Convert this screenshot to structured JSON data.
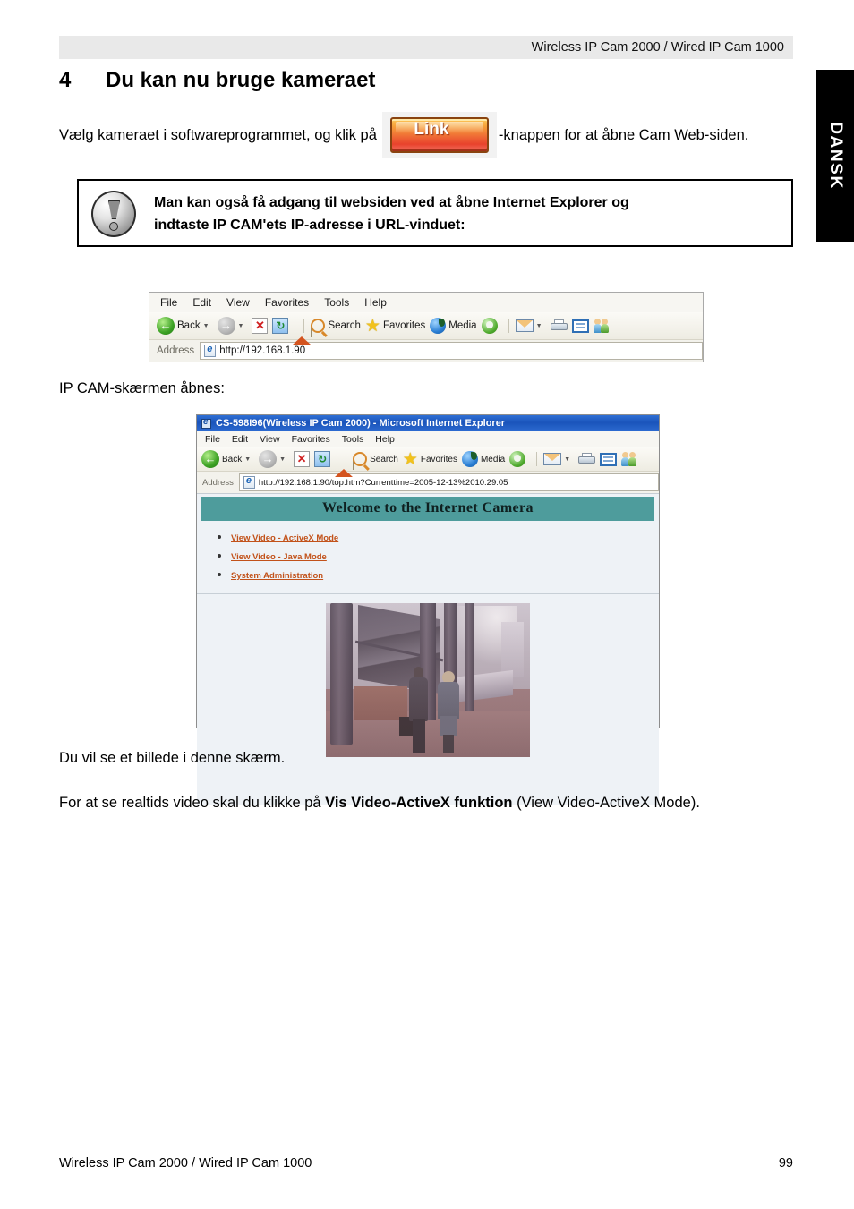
{
  "page": {
    "header_title": "Wireless IP Cam 2000 / Wired IP Cam 1000",
    "side_tab_label": "DANSK",
    "footer_left": "Wireless IP Cam 2000 / Wired IP Cam 1000",
    "footer_page_number": "99"
  },
  "section": {
    "number": "4",
    "heading": "Du kan nu bruge kameraet"
  },
  "intro": {
    "part1": "Vælg kameraet i softwareprogrammet, og klik på",
    "button_label": "Link",
    "part2": "-knappen for at åbne Cam Web-siden."
  },
  "note": {
    "icon": "exclamation-circle-icon",
    "line1": "Man kan også få adgang til websiden ved at åbne Internet Explorer og",
    "line2": "indtaste IP CAM'ets IP-adresse i URL-vinduet:"
  },
  "browser_toolbar_shot": {
    "menus": [
      "File",
      "Edit",
      "View",
      "Favorites",
      "Tools",
      "Help"
    ],
    "toolbar": {
      "back_label": "Back",
      "search_label": "Search",
      "favorites_label": "Favorites",
      "media_label": "Media"
    },
    "address_label": "Address",
    "address_value": "http://192.168.1.90"
  },
  "caption_ipcam": "IP CAM-skærmen åbnes:",
  "browser_window_shot": {
    "title": "CS-598I96(Wireless IP Cam 2000) - Microsoft Internet Explorer",
    "menus": [
      "File",
      "Edit",
      "View",
      "Favorites",
      "Tools",
      "Help"
    ],
    "toolbar": {
      "back_label": "Back",
      "search_label": "Search",
      "favorites_label": "Favorites",
      "media_label": "Media"
    },
    "address_label": "Address",
    "address_value": "http://192.168.1.90/top.htm?Currenttime=2005-12-13%2010:29:05",
    "page": {
      "banner": "Welcome to the Internet Camera",
      "banner_color": "#4e9c9c",
      "link_color": "#c2521a",
      "links": [
        "View Video - ActiveX Mode",
        "View Video - Java Mode",
        "System Administration"
      ],
      "photo_alt": "live camera view of two people walking in a plaza"
    }
  },
  "paragraphs": {
    "billede": "Du vil se et billede i denne skærm.",
    "realtids_part1": "For at se realtids video skal du klikke på ",
    "realtids_bold": "Vis Video-ActiveX funktion",
    "realtids_part2": " (View Video-ActiveX Mode)."
  }
}
